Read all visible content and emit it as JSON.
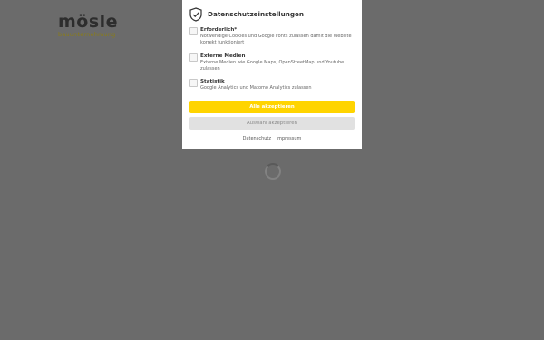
{
  "logo": {
    "main": "mösle",
    "sub": "bauunternehmung"
  },
  "consent": {
    "title": "Datenschutzeinstellungen",
    "options": [
      {
        "title": "Erforderlich*",
        "description": "Notwendige Cookies und Google Fonts zulassen damit die Website korrekt funktioniert"
      },
      {
        "title": "Externe Medien",
        "description": "Externe Medien wie Google Maps, OpenStreetMap und Youtube zulassen"
      },
      {
        "title": "Statistik",
        "description": "Google Analytics und Matomo Analytics zulassen"
      }
    ],
    "accept_all": "Alle akzeptieren",
    "accept_selection": "Auswahl akzeptieren",
    "links": {
      "privacy": "Datenschutz",
      "imprint": "Impressum"
    }
  },
  "colors": {
    "overlay": "#6b6b6b",
    "accent": "#ffd400",
    "secondary_button": "#e1e1e1"
  }
}
